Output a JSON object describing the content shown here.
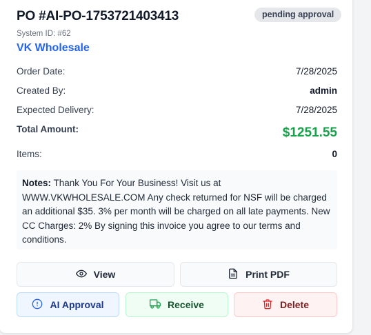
{
  "header": {
    "title": "PO #AI-PO-1753721403413",
    "status_badge": "pending approval",
    "system_id": "System ID: #62",
    "supplier": "VK Wholesale"
  },
  "details": {
    "order_date_label": "Order Date:",
    "order_date": "7/28/2025",
    "created_by_label": "Created By:",
    "created_by": "admin",
    "expected_delivery_label": "Expected Delivery:",
    "expected_delivery": "7/28/2025",
    "total_label": "Total Amount:",
    "total": "$1251.55",
    "items_label": "Items:",
    "items": "0"
  },
  "notes": {
    "label": "Notes:",
    "text": "Thank You For Your Business! Visit us at WWW.VKWHOLESALE.COM Any check returned for NSF will be charged an additional $35. 3% per month will be charged on all late payments. New CC Charges: 2% By signing this invoice you agree to our terms and conditions."
  },
  "actions": {
    "view": "View",
    "print_pdf": "Print PDF",
    "ai_approval": "AI Approval",
    "receive": "Receive",
    "delete": "Delete"
  },
  "icons": {
    "view": "eye-icon",
    "print_pdf": "file-text-icon",
    "ai_approval": "alert-circle-icon",
    "receive": "truck-icon",
    "delete": "trash-icon"
  },
  "colors": {
    "supplier_link": "#2563eb",
    "total_amount": "#16a34a",
    "ai_icon": "#2563eb",
    "receive_icon": "#16a34a",
    "delete_icon": "#dc2626"
  }
}
